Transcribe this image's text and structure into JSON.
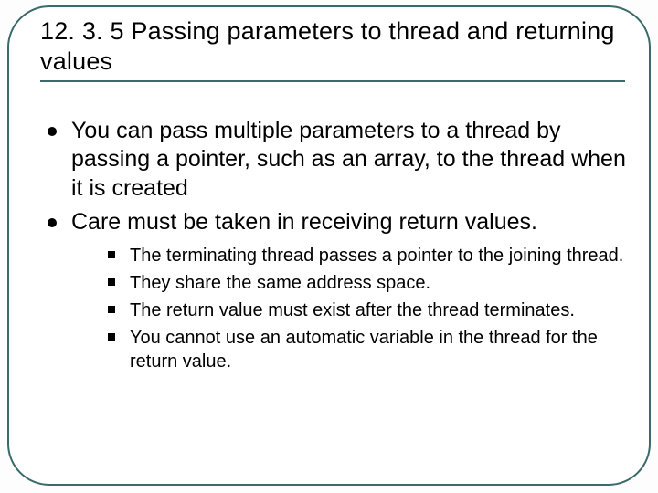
{
  "title": "12. 3. 5 Passing parameters to thread and returning values",
  "bullets": {
    "b0": "You can pass multiple parameters to a thread by passing a pointer, such as an array, to the thread when it is created",
    "b1": "Care must be taken in receiving return values."
  },
  "sub": {
    "s0": "The terminating thread passes a pointer to the joining thread.",
    "s1": "They share the same address space.",
    "s2": "The return value must exist after the thread terminates.",
    "s3": "You cannot use an automatic variable in the thread for the return value."
  }
}
